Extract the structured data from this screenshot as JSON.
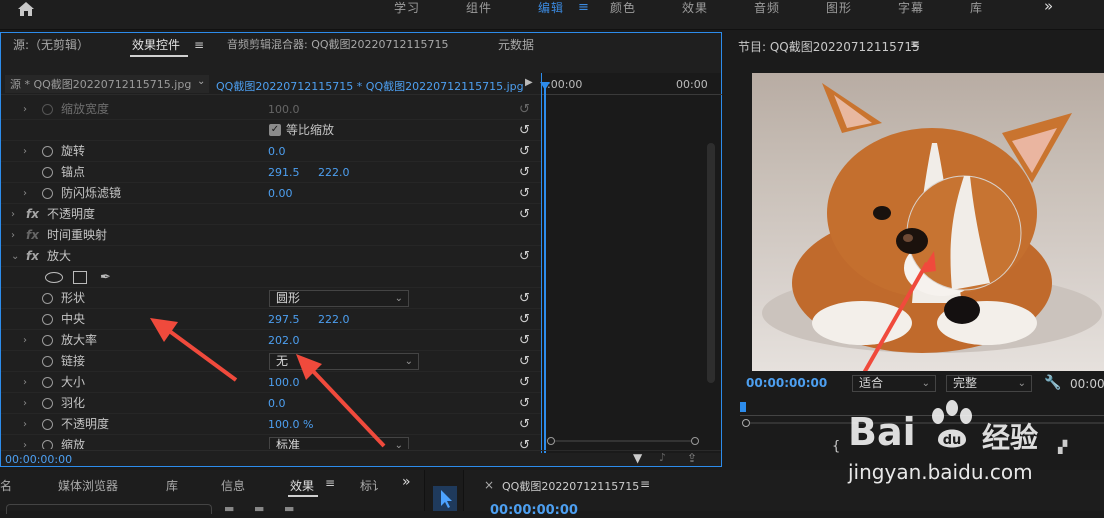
{
  "workspaces": [
    "学习",
    "组件",
    "编辑",
    "颜色",
    "效果",
    "音频",
    "图形",
    "字幕",
    "库"
  ],
  "topbar": {
    "active_index": 2,
    "more": "»"
  },
  "source_tabs": {
    "source": "源:（无剪辑）",
    "effect_controls": "效果控件",
    "audio_mixer": "音频剪辑混合器: QQ截图20220712115715",
    "metadata": "元数据"
  },
  "clip_selector": {
    "master": "源 * QQ截图20220712115715.jpg",
    "sequence": "QQ截图20220712115715 * QQ截图20220712115715.jpg",
    "play": "▶"
  },
  "timeline_header": {
    "t1": ":00:00",
    "t2": "00:00"
  },
  "properties": {
    "scale_width": {
      "label": "缩放宽度",
      "value": "100.0"
    },
    "uniform_scale": {
      "label": "等比缩放"
    },
    "rotation": {
      "label": "旋转",
      "value": "0.0"
    },
    "anchor": {
      "label": "锚点",
      "x": "291.5",
      "y": "222.0"
    },
    "antiflicker": {
      "label": "防闪烁滤镜",
      "value": "0.00"
    },
    "opacity_group": {
      "label": "不透明度"
    },
    "time_remap": {
      "label": "时间重映射"
    },
    "magnify": {
      "label": "放大"
    },
    "shape": {
      "label": "形状",
      "value": "圆形"
    },
    "center": {
      "label": "中央",
      "x": "297.5",
      "y": "222.0"
    },
    "magnification": {
      "label": "放大率",
      "value": "202.0"
    },
    "link": {
      "label": "链接",
      "value": "无"
    },
    "size": {
      "label": "大小",
      "value": "100.0"
    },
    "feather": {
      "label": "羽化",
      "value": "0.0"
    },
    "opacity": {
      "label": "不透明度",
      "value": "100.0 %"
    },
    "scaling": {
      "label": "缩放",
      "value": "标准"
    }
  },
  "ec_timecode": "00:00:00:00",
  "program": {
    "title": "节目: QQ截图20220712115715",
    "timecode": "00:00:00:00",
    "fit": "适合",
    "quality": "完整",
    "timecode_right": "00:00"
  },
  "bottom_tabs": {
    "name": "名",
    "media_browser": "媒体浏览器",
    "library": "库",
    "info": "信息",
    "effects": "效果",
    "markers": "标讠",
    "more": "»"
  },
  "timeline_tab": {
    "close": "×",
    "title": "QQ截图20220712115715",
    "timecode": "00:00:00:00"
  },
  "watermark": {
    "brand": "Bai",
    "brand2": "经验",
    "url": "jingyan.baidu.com"
  },
  "colors": {
    "accent": "#2d8ceb",
    "value": "#4d9ff0",
    "annotation_arrow": "#f04a3c"
  }
}
